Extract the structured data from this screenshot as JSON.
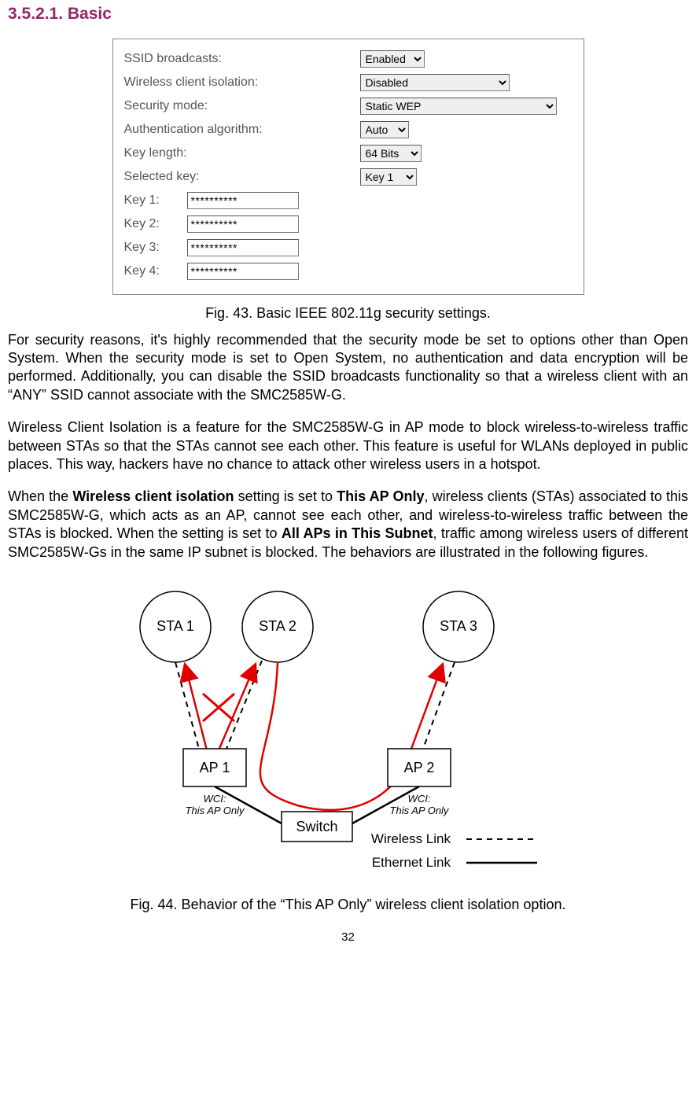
{
  "heading": "3.5.2.1. Basic",
  "panel": {
    "ssid_label": "SSID broadcasts:",
    "ssid_value": "Enabled",
    "iso_label": "Wireless client isolation:",
    "iso_value": "Disabled",
    "sec_label": "Security mode:",
    "sec_value": "Static WEP",
    "auth_label": "Authentication algorithm:",
    "auth_value": "Auto",
    "keylen_label": "Key length:",
    "keylen_value": "64 Bits",
    "selkey_label": "Selected key:",
    "selkey_value": "Key 1",
    "keys": [
      {
        "label": "Key 1:",
        "value": "**********"
      },
      {
        "label": "Key 2:",
        "value": "**********"
      },
      {
        "label": "Key 3:",
        "value": "**********"
      },
      {
        "label": "Key 4:",
        "value": "**********"
      }
    ]
  },
  "caption1": "Fig. 43. Basic IEEE 802.11g security settings.",
  "para1": "For security reasons, it's highly recommended that the security mode be set to options other than Open System. When the security mode is set to Open System, no authentication and data encryption will be performed. Additionally, you can disable the SSID broadcasts functionality so that a wireless client with an “ANY” SSID cannot associate with the SMC2585W-G.",
  "para2": "Wireless Client Isolation is a feature for the SMC2585W-G in AP mode to block wireless-to-wireless traffic between STAs so that the STAs cannot see each other. This feature is useful for WLANs deployed in public places. This way, hackers have no chance to attack other wireless users in a hotspot.",
  "para3_a": "When the ",
  "para3_b": "Wireless client isolation",
  "para3_c": " setting is set to ",
  "para3_d": "This AP Only",
  "para3_e": ", wireless clients (STAs) associated to this SMC2585W-G, which acts as an AP, cannot see each other, and wireless-to-wireless traffic between the STAs is blocked. When the setting is set to ",
  "para3_f": "All APs in This Subnet",
  "para3_g": ", traffic among wireless users of different SMC2585W-Gs in the same IP subnet is blocked. The behaviors are illustrated in the following figures.",
  "diagram": {
    "sta1": "STA 1",
    "sta2": "STA 2",
    "sta3": "STA 3",
    "ap1": "AP 1",
    "ap2": "AP 2",
    "switch": "Switch",
    "wci1a": "WCI:",
    "wci1b": "This AP Only",
    "wci2a": "WCI:",
    "wci2b": "This AP Only",
    "legend_w": "Wireless Link",
    "legend_e": "Ethernet Link"
  },
  "caption2": "Fig. 44. Behavior of the “This AP Only” wireless client isolation option.",
  "page": "32"
}
